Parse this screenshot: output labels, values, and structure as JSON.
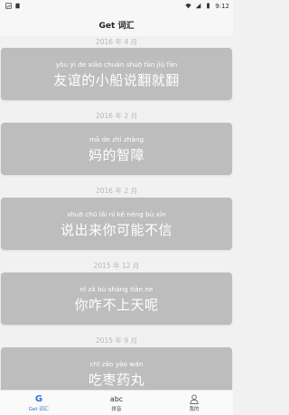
{
  "status_bar": {
    "time": "9:12"
  },
  "app_bar": {
    "title": "Get 词汇"
  },
  "feed": [
    {
      "date": "2016 年 4 月",
      "pinyin": "yǒu yì de xiǎo chuán shuō fān jiù fān",
      "phrase": "友谊的小船说翻就翻"
    },
    {
      "date": "2016 年 2 月",
      "pinyin": "mā de zhì zhàng",
      "phrase": "妈的智障"
    },
    {
      "date": "2016 年 2 月",
      "pinyin": "shuō chū lái nǐ kě néng bù xìn",
      "phrase": "说出来你可能不信"
    },
    {
      "date": "2015 年 12 月",
      "pinyin": "nǐ zǎ bù shàng tiān ne",
      "phrase": "你咋不上天呢"
    },
    {
      "date": "2015 年 9 月",
      "pinyin": "chī zǎo yào wán",
      "phrase": "吃枣药丸"
    }
  ],
  "bottom_nav": [
    {
      "label": "Get 词汇",
      "icon": "g-icon",
      "glyph": "G",
      "active": true
    },
    {
      "label": "拼音",
      "icon": "abc-icon",
      "glyph": "abc",
      "active": false
    },
    {
      "label": "我的",
      "icon": "person-icon",
      "active": false
    }
  ],
  "colors": {
    "background": "#f1f1f1",
    "card": "#bdbdbd",
    "accent": "#2f6fd6",
    "date_text": "#b7b7b7"
  }
}
